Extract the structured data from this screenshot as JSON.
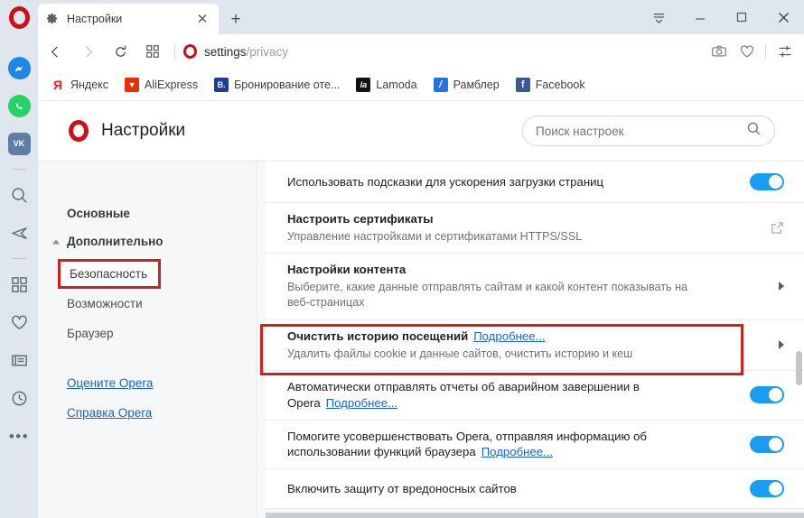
{
  "window": {
    "controls": [
      {
        "name": "tab-menu",
        "glyph": "tab-menu-icon"
      },
      {
        "name": "minimize",
        "glyph": "minimize-icon"
      },
      {
        "name": "maximize",
        "glyph": "maximize-icon"
      },
      {
        "name": "close",
        "glyph": "close-icon"
      }
    ]
  },
  "tab": {
    "title": "Настройки",
    "favicon": "gear-icon",
    "close_label": "✕",
    "new_tab_label": "+"
  },
  "navbar": {
    "back_label": "‹",
    "forward_label": "›",
    "reload_label": "⟳",
    "speeddial_label": "speed-dial-icon",
    "url_main": "settings",
    "url_path": "/privacy",
    "right_icons": [
      "camera-icon",
      "heart-icon",
      "easy-setup-icon"
    ]
  },
  "bookmarks": [
    {
      "label": "Яндекс",
      "icon_text": "Я",
      "bg": "#ffffff",
      "fg": "#e4231f"
    },
    {
      "label": "AliExpress",
      "icon_text": "▼",
      "bg": "#e62e04",
      "fg": "#ffffff"
    },
    {
      "label": "Бронирование оте...",
      "icon_text": "B.",
      "bg": "#1c3f94",
      "fg": "#ffffff"
    },
    {
      "label": "Lamoda",
      "icon_text": "la",
      "bg": "#111111",
      "fg": "#ffffff"
    },
    {
      "label": "Рамблер",
      "icon_text": "/",
      "bg": "#2274e0",
      "fg": "#ffffff"
    },
    {
      "label": "Facebook",
      "icon_text": "f",
      "bg": "#3b5998",
      "fg": "#ffffff"
    }
  ],
  "opera_sidebar": {
    "logo": "opera-logo",
    "items": [
      {
        "name": "messenger-icon",
        "type": "messenger"
      },
      {
        "name": "whatsapp-icon",
        "type": "whatsapp"
      },
      {
        "name": "vk-icon",
        "type": "vk",
        "text": "VK"
      },
      {
        "name": "separator-1",
        "type": "separator"
      },
      {
        "name": "search-icon",
        "type": "svg-search"
      },
      {
        "name": "send-icon",
        "type": "svg-send"
      },
      {
        "name": "separator-2",
        "type": "separator"
      },
      {
        "name": "speed-dial-icon",
        "type": "svg-grid"
      },
      {
        "name": "bookmarks-heart-icon",
        "type": "svg-heart"
      },
      {
        "name": "news-icon",
        "type": "svg-news"
      },
      {
        "name": "history-clock-icon",
        "type": "svg-clock"
      },
      {
        "name": "more-options-icon",
        "type": "dots",
        "text": "•••"
      }
    ]
  },
  "settings_header": {
    "title": "Настройки",
    "search_placeholder": "Поиск настроек",
    "search_value": ""
  },
  "nav_panel": {
    "group_basic": "Основные",
    "group_advanced": "Дополнительно",
    "items": [
      {
        "label": "Безопасность",
        "highlighted": true
      },
      {
        "label": "Возможности",
        "highlighted": false
      },
      {
        "label": "Браузер",
        "highlighted": false
      }
    ],
    "links": [
      {
        "label": "Оцените Opera"
      },
      {
        "label": "Справка Opera"
      }
    ]
  },
  "settings_rows": [
    {
      "title": "Использовать подсказки для ускорения загрузки страниц",
      "title_bold": false,
      "subtitle": "",
      "link": "",
      "control": "toggle",
      "toggle_on": true,
      "highlighted": false
    },
    {
      "title": "Настроить сертификаты",
      "title_bold": true,
      "subtitle": "Управление настройками и сертификатами HTTPS/SSL",
      "link": "",
      "control": "external-link",
      "toggle_on": false,
      "highlighted": false
    },
    {
      "title": "Настройки контента",
      "title_bold": true,
      "subtitle": "Выберите, какие данные отправлять сайтам и какой контент показывать на веб-страницах",
      "link": "",
      "control": "chevron",
      "toggle_on": false,
      "highlighted": false
    },
    {
      "title": "Очистить историю посещений",
      "title_bold": true,
      "subtitle": "Удалить файлы cookie и данные сайтов, очистить историю и кеш",
      "link": "Подробнее...",
      "control": "chevron",
      "toggle_on": false,
      "highlighted": true
    },
    {
      "title": "Автоматически отправлять отчеты об аварийном завершении в Opera",
      "title_bold": false,
      "subtitle": "",
      "link": "Подробнее...",
      "control": "toggle",
      "toggle_on": true,
      "highlighted": false
    },
    {
      "title": "Помогите усовершенствовать Opera, отправляя информацию об использовании функций браузера",
      "title_bold": false,
      "subtitle": "",
      "link": "Подробнее...",
      "control": "toggle",
      "toggle_on": true,
      "highlighted": false
    },
    {
      "title": "Включить защиту от вредоносных сайтов",
      "title_bold": false,
      "subtitle": "",
      "link": "",
      "control": "toggle",
      "toggle_on": true,
      "highlighted": false
    }
  ],
  "colors": {
    "opera_red": "#cc0f16",
    "toggle_blue": "#1a9df0",
    "link_blue": "#1964c8",
    "annotation_red": "#d31f1f",
    "chrome_bg": "#dfe6ee",
    "page_bg": "#f6f7f9"
  }
}
